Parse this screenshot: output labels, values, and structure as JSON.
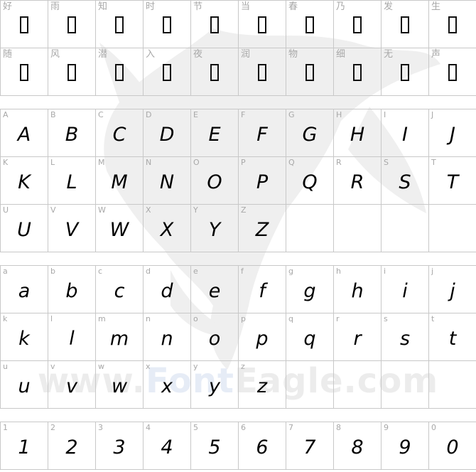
{
  "watermark": {
    "brand_a": "www.",
    "brand_b": "Font",
    "brand_c": "Eagle.com"
  },
  "cjk": [
    "好",
    "雨",
    "知",
    "时",
    "节",
    "当",
    "春",
    "乃",
    "发",
    "生",
    "随",
    "风",
    "潜",
    "入",
    "夜",
    "润",
    "物",
    "细",
    "无",
    "声"
  ],
  "uppercase": [
    "A",
    "B",
    "C",
    "D",
    "E",
    "F",
    "G",
    "H",
    "I",
    "J",
    "K",
    "L",
    "M",
    "N",
    "O",
    "P",
    "Q",
    "R",
    "S",
    "T",
    "U",
    "V",
    "W",
    "X",
    "Y",
    "Z",
    "",
    "",
    "",
    ""
  ],
  "lowercase": [
    "a",
    "b",
    "c",
    "d",
    "e",
    "f",
    "g",
    "h",
    "i",
    "j",
    "k",
    "l",
    "m",
    "n",
    "o",
    "p",
    "q",
    "r",
    "s",
    "t",
    "u",
    "v",
    "w",
    "x",
    "y",
    "z",
    "",
    "",
    "",
    ""
  ],
  "digits": [
    "1",
    "2",
    "3",
    "4",
    "5",
    "6",
    "7",
    "8",
    "9",
    "0"
  ]
}
